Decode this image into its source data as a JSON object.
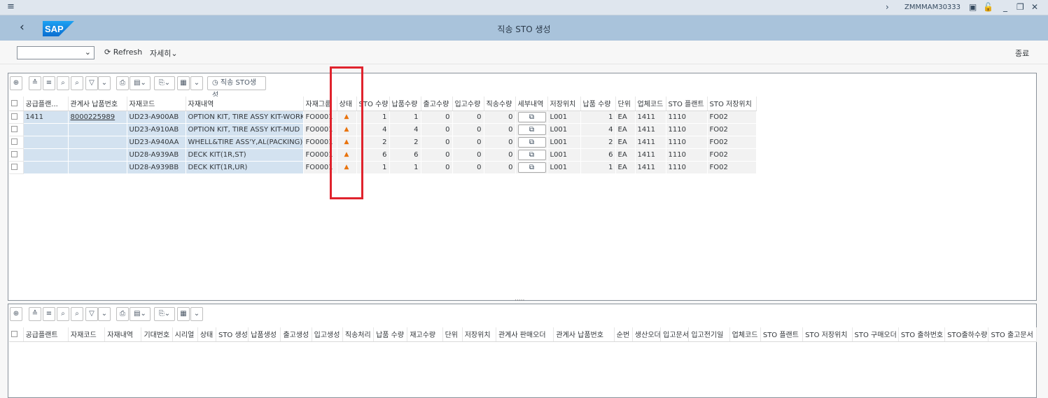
{
  "titlebar": {
    "menu": "≡",
    "transaction": "ZMMMAM30333"
  },
  "shell": {
    "title": "직송 STO 생성",
    "logo": "SAP"
  },
  "toolbar": {
    "refresh": "Refresh",
    "more": "자세히",
    "exit": "종료",
    "variant_value": ""
  },
  "alv_toolbar": {
    "create_sto": "직송 STO생성"
  },
  "upper_grid": {
    "columns": [
      "공급플랜...",
      "관계사 납품번호",
      "자재코드",
      "자재내역",
      "자재그룹",
      "상태",
      "STO 수량",
      "납품수량",
      "출고수량",
      "입고수량",
      "직송수량",
      "세부내역",
      "저장위치",
      "납품 수량",
      "단위",
      "업체코드",
      "STO 플랜트",
      "STO 저장위치"
    ],
    "rows": [
      {
        "plant": "1411",
        "delivery": "8000225989",
        "material": "UD23-A900AB",
        "desc": "OPTION KIT, TIRE ASSY KIT-WORK",
        "group": "FO0001",
        "sto_qty": "1",
        "dlv_qty": "1",
        "gi_qty": "0",
        "gr_qty": "0",
        "direct_qty": "0",
        "sloc": "L001",
        "del_qty": "1",
        "unit": "EA",
        "vendor": "1411",
        "sto_plant": "1110",
        "sto_sloc": "FO02"
      },
      {
        "plant": "",
        "delivery": "",
        "material": "UD23-A910AB",
        "desc": "OPTION KIT, TIRE ASSY KIT-MUD",
        "group": "FO0001",
        "sto_qty": "4",
        "dlv_qty": "4",
        "gi_qty": "0",
        "gr_qty": "0",
        "direct_qty": "0",
        "sloc": "L001",
        "del_qty": "4",
        "unit": "EA",
        "vendor": "1411",
        "sto_plant": "1110",
        "sto_sloc": "FO02"
      },
      {
        "plant": "",
        "delivery": "",
        "material": "UD23-A940AA",
        "desc": "WHELL&TIRE ASS'Y,AL(PACKING)",
        "group": "FO0001",
        "sto_qty": "2",
        "dlv_qty": "2",
        "gi_qty": "0",
        "gr_qty": "0",
        "direct_qty": "0",
        "sloc": "L001",
        "del_qty": "2",
        "unit": "EA",
        "vendor": "1411",
        "sto_plant": "1110",
        "sto_sloc": "FO02"
      },
      {
        "plant": "",
        "delivery": "",
        "material": "UD28-A939AB",
        "desc": "DECK KIT(1R,ST)",
        "group": "FO0001",
        "sto_qty": "6",
        "dlv_qty": "6",
        "gi_qty": "0",
        "gr_qty": "0",
        "direct_qty": "0",
        "sloc": "L001",
        "del_qty": "6",
        "unit": "EA",
        "vendor": "1411",
        "sto_plant": "1110",
        "sto_sloc": "FO02"
      },
      {
        "plant": "",
        "delivery": "",
        "material": "UD28-A939BB",
        "desc": "DECK KIT(1R,UR)",
        "group": "FO0001",
        "sto_qty": "1",
        "dlv_qty": "1",
        "gi_qty": "0",
        "gr_qty": "0",
        "direct_qty": "0",
        "sloc": "L001",
        "del_qty": "1",
        "unit": "EA",
        "vendor": "1411",
        "sto_plant": "1110",
        "sto_sloc": "FO02"
      }
    ]
  },
  "lower_grid": {
    "columns": [
      "공급플랜트",
      "자재코드",
      "자재내역",
      "기대번호",
      "시리얼",
      "상태",
      "STO 생성",
      "납품생성",
      "출고생성",
      "입고생성",
      "직송처리",
      "납품 수량",
      "재고수량",
      "단위",
      "저장위치",
      "관계사 판매오더",
      "관계사 납품번호",
      "순번",
      "생산오더",
      "입고문서",
      "입고전기일",
      "업체코드",
      "STO 플랜트",
      "STO 저장위치",
      "STO 구매오더",
      "STO 출하번호",
      "STO출하수량",
      "STO 출고문서"
    ]
  },
  "colors": {
    "shell": "#a9c3db",
    "titlebar": "#dfe6ee",
    "key_cell": "#d3e2f0",
    "warning": "#e9730c",
    "highlight": "#e0232d"
  }
}
